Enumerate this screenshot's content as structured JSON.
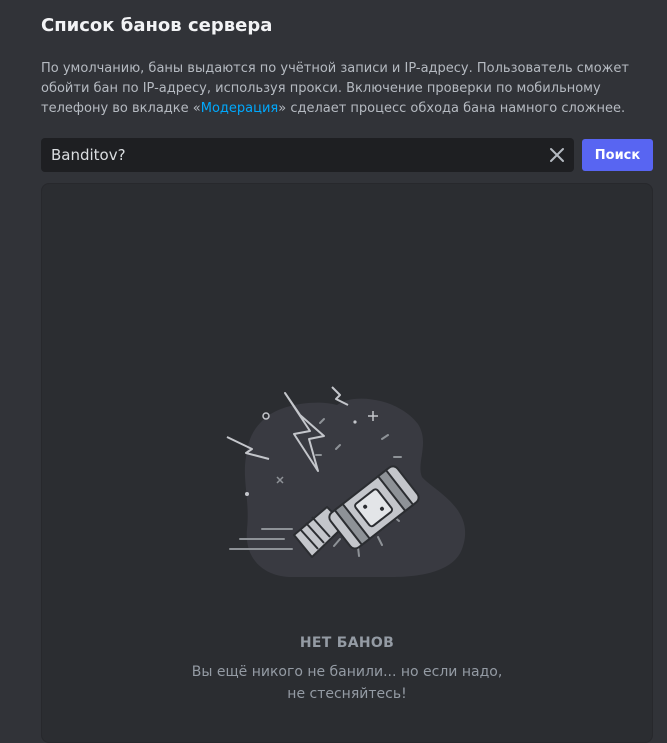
{
  "page": {
    "title": "Список банов сервера",
    "description_before_link": "По умолчанию, баны выдаются по учётной записи и IP-адресу. Пользователь сможет обойти бан по IP-адресу, используя прокси. Включение проверки по мобильному телефону во вкладке «",
    "description_link": "Модерация",
    "description_after_link": "» сделает процесс обхода бана намного сложнее."
  },
  "search": {
    "value": "Banditov?",
    "clear_icon": "close-icon",
    "button_label": "Поиск"
  },
  "empty_state": {
    "illustration": "ban-hammer-icon",
    "title": "НЕТ БАНОВ",
    "subtitle_line1": "Вы ещё никого не банили... но если надо,",
    "subtitle_line2": "не стесняйтесь!"
  },
  "colors": {
    "background": "#313338",
    "panel": "#2b2d31",
    "input": "#1e1f22",
    "accent": "#5865f2",
    "link": "#00a8fc"
  }
}
